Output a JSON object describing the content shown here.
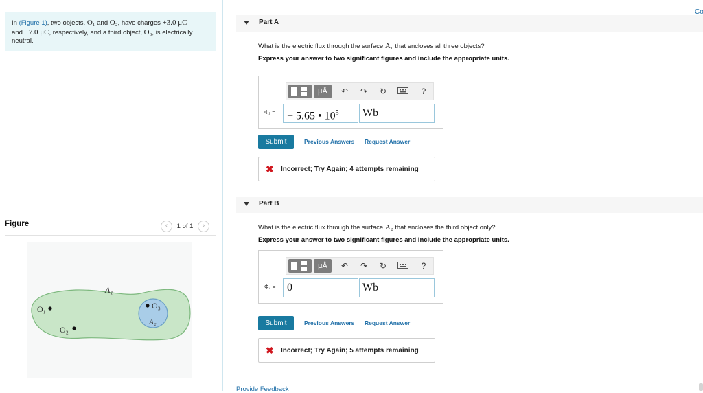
{
  "problem": {
    "t1": "In ",
    "figure_link": "(Figure 1)",
    "t2": ", two objects, ",
    "o1": "O₁",
    "t3": " and ",
    "o2": "O₂",
    "t4": ", have charges ",
    "q1": "+3.0 μC",
    "t5": "and ",
    "q2": "−7.0 μC",
    "t6": ", respectively, and a third object, ",
    "o3": "O₃",
    "t7": ", is electrically neutral."
  },
  "figure": {
    "title": "Figure",
    "page": "1 of 1",
    "label_a1": "A₁",
    "label_a2": "A₂",
    "label_o1": "O₁",
    "label_o2": "O₂",
    "label_o3": "O₃"
  },
  "toolbar": {
    "mu_label": "μÅ",
    "undo_icon": "undo-icon",
    "redo_icon": "redo-icon",
    "reset_icon": "reset-icon",
    "keyboard_icon": "keyboard-icon",
    "help_label": "?"
  },
  "part_a": {
    "label": "Part A",
    "question_1": "What is the electric flux through the surface ",
    "question_sym": "A₁",
    "question_2": " that encloses all three objects?",
    "instructions": "Express your answer to two significant figures and include the appropriate units.",
    "symbol_label": "Φ₁ =",
    "value": "− 5.65 • 10",
    "exponent": "5",
    "unit": "Wb",
    "submit": "Submit",
    "previous_answers": "Previous Answers",
    "request_answer": "Request Answer",
    "feedback": "Incorrect; Try Again; 4 attempts remaining"
  },
  "part_b": {
    "label": "Part B",
    "question_1": "What is the electric flux through the surface ",
    "question_sym": "A₂",
    "question_2": " that encloses the third object only?",
    "instructions": "Express your answer to two significant figures and include the appropriate units.",
    "symbol_label": "Φ₂ =",
    "value": "0",
    "unit": "Wb",
    "submit": "Submit",
    "previous_answers": "Previous Answers",
    "request_answer": "Request Answer",
    "feedback": "Incorrect; Try Again; 5 attempts remaining"
  },
  "footer": {
    "provide_feedback": "Provide Feedback",
    "corner_text": "Co"
  },
  "colors": {
    "accent": "#197aa0",
    "link": "#1f6fa8",
    "error": "#d0161e",
    "problem_bg": "#e8f6f8"
  }
}
